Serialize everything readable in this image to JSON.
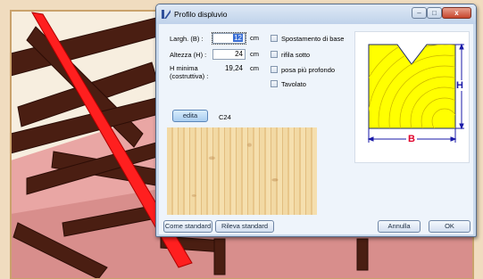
{
  "window": {
    "title": "Profilo displuvio"
  },
  "fields": {
    "width": {
      "label": "Largh. (B) :",
      "value": "12",
      "unit": "cm"
    },
    "height": {
      "label": "Altezza (H) :",
      "value": "24",
      "unit": "cm"
    },
    "min_height": {
      "label_line1": "H minima",
      "label_line2": "(costruttiva) :",
      "value": "19,24",
      "unit": "cm"
    }
  },
  "options": [
    {
      "label": "Spostamento di base",
      "checked": false
    },
    {
      "label": "rifila sotto",
      "checked": false
    },
    {
      "label": "posa più profondo",
      "checked": false
    },
    {
      "label": "Tavolato",
      "checked": false
    }
  ],
  "material": {
    "edit_label": "edita",
    "name": "C24"
  },
  "diagram": {
    "b_label": "B",
    "h_label": "H",
    "colors": {
      "section": "#ffff00",
      "dims": "#1a1aa8",
      "labels": "#e0002a"
    }
  },
  "buttons": {
    "standard": "Come standard",
    "detect": "Rileva standard",
    "cancel": "Annulla",
    "ok": "OK"
  }
}
